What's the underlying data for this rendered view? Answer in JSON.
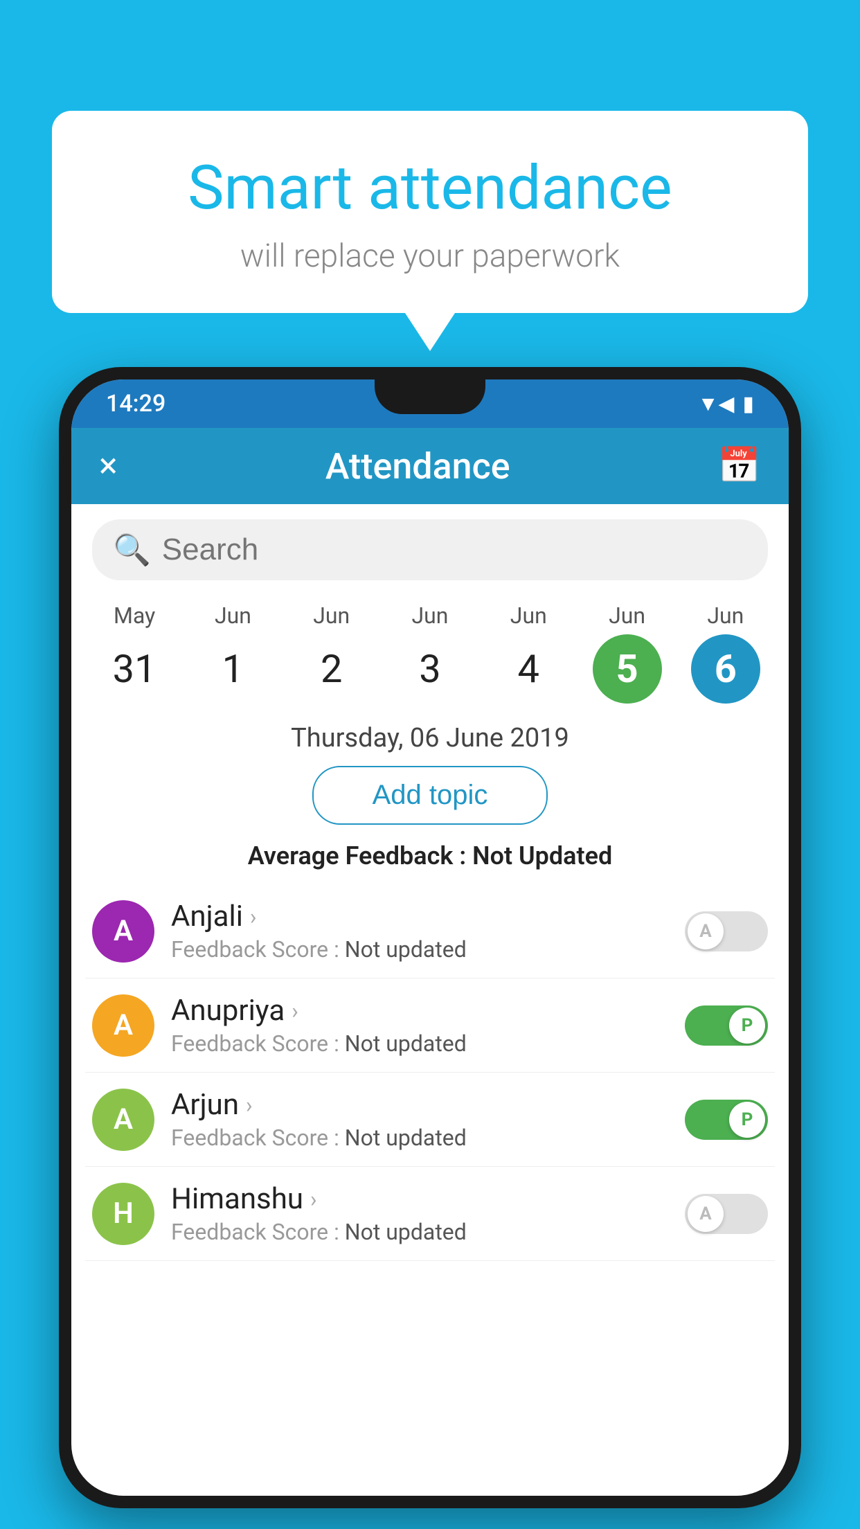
{
  "background_color": "#1ab8e8",
  "speech_bubble": {
    "title": "Smart attendance",
    "subtitle": "will replace your paperwork"
  },
  "status_bar": {
    "time": "14:29",
    "icons": [
      "wifi",
      "signal",
      "battery"
    ]
  },
  "app_bar": {
    "title": "Attendance",
    "close_label": "×",
    "calendar_label": "📅"
  },
  "search": {
    "placeholder": "Search"
  },
  "calendar": {
    "days": [
      {
        "month": "May",
        "date": "31",
        "style": "normal"
      },
      {
        "month": "Jun",
        "date": "1",
        "style": "normal"
      },
      {
        "month": "Jun",
        "date": "2",
        "style": "normal"
      },
      {
        "month": "Jun",
        "date": "3",
        "style": "normal"
      },
      {
        "month": "Jun",
        "date": "4",
        "style": "normal"
      },
      {
        "month": "Jun",
        "date": "5",
        "style": "today"
      },
      {
        "month": "Jun",
        "date": "6",
        "style": "selected"
      }
    ]
  },
  "selected_date": "Thursday, 06 June 2019",
  "add_topic_label": "Add topic",
  "average_feedback": {
    "label": "Average Feedback : ",
    "value": "Not Updated"
  },
  "students": [
    {
      "name": "Anjali",
      "feedback_label": "Feedback Score : ",
      "feedback_value": "Not updated",
      "avatar_letter": "A",
      "avatar_color": "#9c27b0",
      "toggle": "off",
      "toggle_letter": "A"
    },
    {
      "name": "Anupriya",
      "feedback_label": "Feedback Score : ",
      "feedback_value": "Not updated",
      "avatar_letter": "A",
      "avatar_color": "#f5a623",
      "toggle": "on",
      "toggle_letter": "P"
    },
    {
      "name": "Arjun",
      "feedback_label": "Feedback Score : ",
      "feedback_value": "Not updated",
      "avatar_letter": "A",
      "avatar_color": "#8bc34a",
      "toggle": "on",
      "toggle_letter": "P"
    },
    {
      "name": "Himanshu",
      "feedback_label": "Feedback Score : ",
      "feedback_value": "Not updated",
      "avatar_letter": "H",
      "avatar_color": "#8bc34a",
      "toggle": "off",
      "toggle_letter": "A"
    }
  ]
}
